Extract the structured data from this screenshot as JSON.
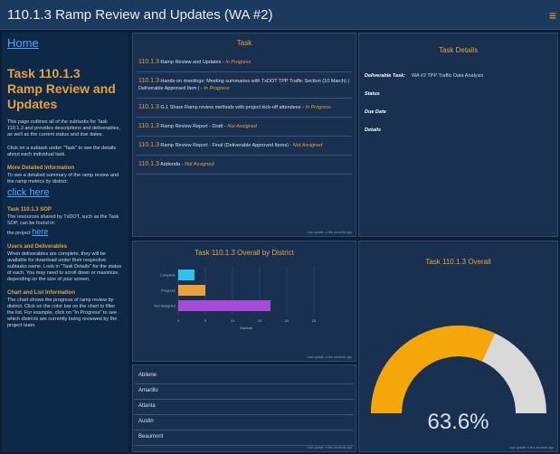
{
  "app": {
    "title": "110.1.3 Ramp Review and Updates (WA #2)",
    "menu_glyph": "≡"
  },
  "sidebar": {
    "home_label": "Home",
    "task_title": "Task 110.1.3\nRamp Review and Updates",
    "intro": "This page outlines all of the subtasks for Task 110.1.3 and provides descriptions and deliverables, as well as the current status and due dates.",
    "click_hint": "Click on a subtask under \"Task\" to see the details about each individual task.",
    "more_info_heading": "More Detailed Information",
    "more_info_text": "To see a detailed summary of the ramp review and the ramp metrics by district:",
    "click_here": "click here",
    "sop_heading": "Task 110.1.3 SOP",
    "sop_text": "The resources shared by TxDOT, such as the Task SOP, can be found in:",
    "sop_link_prefix": "the project",
    "sop_link": "here",
    "users_heading": "Users and Deliverables",
    "users_text": "When deliverables are complete, they will be available for download under their respective subtasks name. Look in \"Task Details\" for the status of each. You may need to scroll down or maximize, depending on the size of your screen.",
    "chart_heading": "Chart and List Information",
    "chart_text": "The chart shows the progress of ramp review by district. Click on the color bar on the chart to filter the list. For example, click on \"In Progress\" to see which districts are currently being reviewed by the project team."
  },
  "task_panel": {
    "title": "Task",
    "rows": [
      {
        "num": "110.1.3",
        "text": "Ramp Review and Updates - ",
        "status": "In Progress"
      },
      {
        "num": "110.1.3",
        "text": "Hands-on meetings: Meeting summaries with TxDOT TPP Traffic Section (10 March) | Deliverable Approved Item | - ",
        "status": "In Progress"
      },
      {
        "num": "110.1.3",
        "text": "G.1 Share Ramp review methods with project kick-off attendees - ",
        "status": "In Progress"
      },
      {
        "num": "110.1.3",
        "text": "Ramp Review Report - Draft - ",
        "status": "Not Assigned"
      },
      {
        "num": "110.1.3",
        "text": "Ramp Review Report - Final (Deliverable Approved Items) - ",
        "status": "Not Assigned"
      },
      {
        "num": "110.1.3",
        "text": "Addenda - ",
        "status": "Not Assigned"
      }
    ],
    "attribution": "Last update: a few seconds ago"
  },
  "details_panel": {
    "title": "Task Details",
    "rows": [
      {
        "label": "Deliverable Task:",
        "value": "WA #2 TPP Traffic Data Analysis"
      },
      {
        "label": "Status",
        "value": ""
      },
      {
        "label": "Due Date",
        "value": ""
      },
      {
        "label": "Details",
        "value": ""
      }
    ]
  },
  "district_chart_panel": {
    "title": "Task 110.1.3 Overall by District",
    "attribution": "Last update: a few seconds ago"
  },
  "chart_data": {
    "type": "bar",
    "orientation": "horizontal",
    "title": "Task 110.1.3 Overall by District",
    "categories": [
      "Complete",
      "Progress",
      "Not Assigned"
    ],
    "values": [
      3,
      5,
      17
    ],
    "colors": [
      "#2ec4f0",
      "#e8a23a",
      "#a64ad8"
    ],
    "xlabel": "Districts",
    "ylabel": "",
    "xlim": [
      0,
      25
    ],
    "xticks": [
      "0",
      "5",
      "10",
      "15",
      "20",
      "25"
    ],
    "grid": true
  },
  "district_list": {
    "items": [
      "Abilene",
      "Amarillo",
      "Atlanta",
      "Austin",
      "Beaumont"
    ],
    "attribution": "Last update: a few seconds ago"
  },
  "overall_panel": {
    "title": "Task 110.1.3 Overall",
    "percent_label": "63.6%",
    "percent_value": 63.6,
    "gauge_color": "#f5a70a",
    "track_color": "#d9d9d9",
    "attribution": "Last update: a few seconds ago"
  }
}
